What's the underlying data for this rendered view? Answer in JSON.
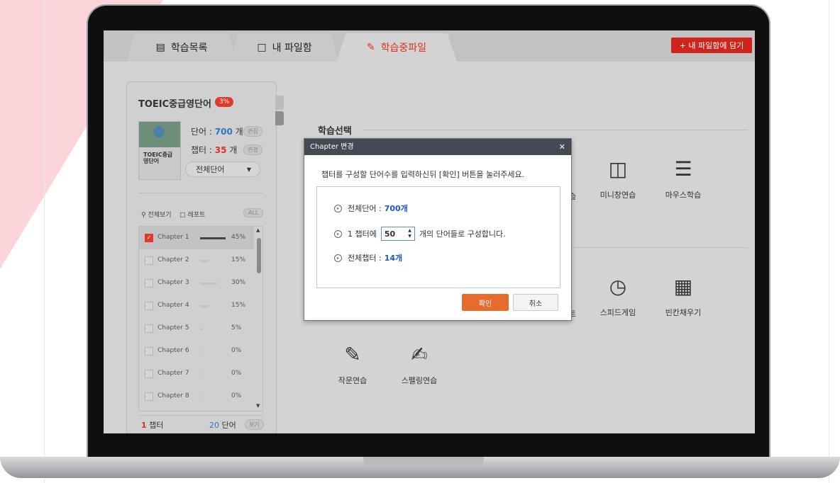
{
  "tabs": [
    {
      "label": "학습목록",
      "icon": "list-doc-icon"
    },
    {
      "label": "내 파일함",
      "icon": "folder-icon"
    },
    {
      "label": "학습중파일",
      "icon": "pencil-icon"
    }
  ],
  "add_button": "+ 내 파일함에 담기",
  "book": {
    "title": "TOEIC중급영단어",
    "progress_badge": "3%",
    "cover_title": "TOEIC중급\n영단어",
    "words_label": "단어 :",
    "words_count": "700",
    "words_unit": "개",
    "words_btn": "편집",
    "chapters_label": "챕터 :",
    "chapters_count": "35",
    "chapters_unit": "개",
    "chapters_btn": "변경",
    "select_value": "전체단어"
  },
  "toolbar": {
    "view_all": "전체보기",
    "report": "레포트",
    "all": "ALL"
  },
  "chapters": [
    {
      "name": "Chapter 1",
      "pct": "45%",
      "checked": true,
      "progress": 0.45
    },
    {
      "name": "Chapter 2",
      "pct": "15%",
      "checked": false,
      "progress": 0.15
    },
    {
      "name": "Chapter 3",
      "pct": "30%",
      "checked": false,
      "progress": 0.3
    },
    {
      "name": "Chapter 4",
      "pct": "15%",
      "checked": false,
      "progress": 0.15
    },
    {
      "name": "Chapter 5",
      "pct": "5%",
      "checked": false,
      "progress": 0.05
    },
    {
      "name": "Chapter 6",
      "pct": "0%",
      "checked": false,
      "progress": 0.0
    },
    {
      "name": "Chapter 7",
      "pct": "0%",
      "checked": false,
      "progress": 0.0
    },
    {
      "name": "Chapter 8",
      "pct": "0%",
      "checked": false,
      "progress": 0.0
    }
  ],
  "summary": {
    "chapters_num": "1",
    "chapters_label": "챕터",
    "words_num": "20",
    "words_label": "단어",
    "view_btn": "보기"
  },
  "section_title": "학습선택",
  "study_items": [
    {
      "label": "미니창연습",
      "icon": "mini-window-icon"
    },
    {
      "label": "마우스학습",
      "icon": "checklist-icon"
    },
    {
      "label": "스피드게임",
      "icon": "alarm-clock-icon"
    },
    {
      "label": "빈칸채우기",
      "icon": "fill-blank-icon"
    },
    {
      "label": "작문연습",
      "icon": "writing-icon"
    },
    {
      "label": "스펠링연습",
      "icon": "spelling-icon"
    }
  ],
  "partial_labels": [
    "습",
    "트"
  ],
  "dialog": {
    "title": "Chapter 변경",
    "message": "챕터를 구성할 단어수를 입력하신뒤 [확인] 버튼을 눌러주세요.",
    "total_words_label": "전체단어 :",
    "total_words_value": "700개",
    "per_chapter_prefix": "1 챕터에",
    "per_chapter_value": "50",
    "per_chapter_suffix": "개의 단어들로 구성합니다.",
    "total_chapters_label": "전체챕터 :",
    "total_chapters_value": "14개",
    "ok": "확인",
    "cancel": "취소"
  }
}
